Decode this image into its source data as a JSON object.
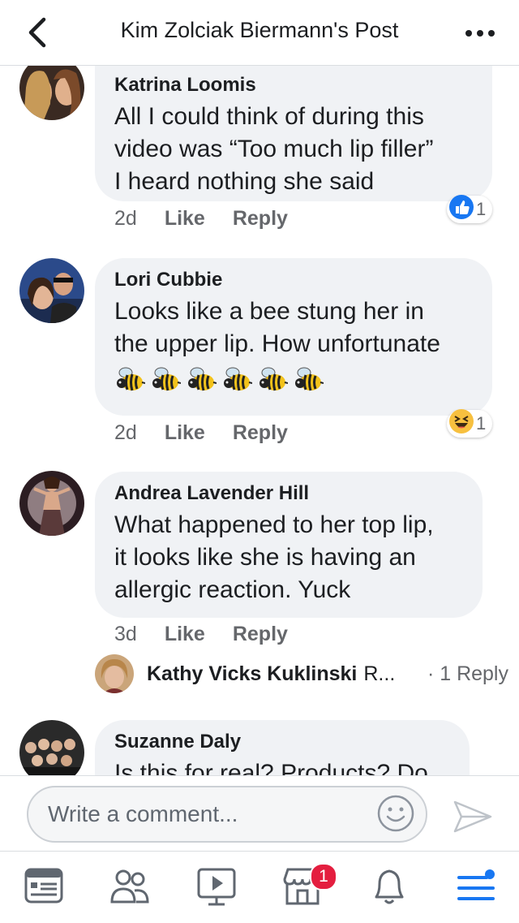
{
  "header": {
    "title": "Kim Zolciak Biermann's Post"
  },
  "comments": [
    {
      "author": "Katrina Loomis",
      "lines": [
        "All I could think of during this",
        "video was “Too much lip filler”",
        "I heard nothing she said"
      ],
      "time": "2d",
      "like": "Like",
      "reply": "Reply",
      "reaction": {
        "type": "like-icon",
        "count": "1"
      }
    },
    {
      "author": "Lori Cubbie",
      "lines": [
        "Looks like a bee stung her in",
        "the upper lip. How unfortunate"
      ],
      "emoji": "🐝🐝🐝🐝🐝🐝",
      "emoji_count": 6,
      "time": "2d",
      "like": "Like",
      "reply": "Reply",
      "reaction": {
        "type": "haha-icon",
        "count": "1"
      }
    },
    {
      "author": "Andrea Lavender Hill",
      "lines": [
        "What happened to her top lip,",
        "it looks like she is having an",
        "allergic reaction. Yuck"
      ],
      "time": "3d",
      "like": "Like",
      "reply": "Reply"
    },
    {
      "author": "Suzanne Daly",
      "lines": [
        "Is this for real? Products? Do"
      ]
    }
  ],
  "reply_preview": {
    "author": "Kathy Vicks Kuklinski",
    "snippet": "R...",
    "count": "· 1 Reply"
  },
  "composer": {
    "placeholder": "Write a comment..."
  },
  "tabbar": {
    "tabs": [
      "news-feed-icon",
      "friends-icon",
      "watch-icon",
      "marketplace-icon",
      "notifications-icon",
      "menu-icon"
    ],
    "marketplace_badge": "1",
    "active_tab": "menu-icon"
  },
  "colors": {
    "accent": "#1877f2",
    "badge": "#e41e3f",
    "bubble": "#f0f2f5",
    "secondary_text": "#65676b"
  }
}
